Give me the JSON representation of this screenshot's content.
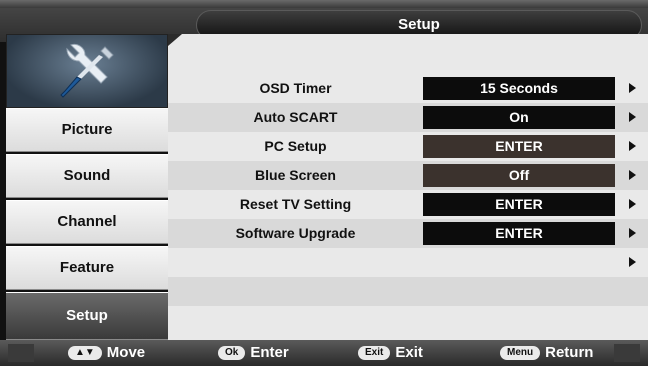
{
  "header": {
    "title": "Setup"
  },
  "sidebar": {
    "icon": "tools-icon",
    "items": [
      {
        "label": "Picture",
        "active": false
      },
      {
        "label": "Sound",
        "active": false
      },
      {
        "label": "Channel",
        "active": false
      },
      {
        "label": "Feature",
        "active": false
      },
      {
        "label": "Setup",
        "active": true
      }
    ]
  },
  "settings": [
    {
      "label": "OSD Timer",
      "value": "15 Seconds"
    },
    {
      "label": "Auto SCART",
      "value": "On"
    },
    {
      "label": "PC Setup",
      "value": "ENTER"
    },
    {
      "label": "Blue Screen",
      "value": "Off"
    },
    {
      "label": "Reset TV Setting",
      "value": "ENTER"
    },
    {
      "label": "Software Upgrade",
      "value": "ENTER"
    },
    {
      "label": "",
      "value": ""
    }
  ],
  "footer": {
    "hints": [
      {
        "key": "▲▼",
        "label": "Move"
      },
      {
        "key": "Ok",
        "label": "Enter"
      },
      {
        "key": "Exit",
        "label": "Exit"
      },
      {
        "key": "Menu",
        "label": "Return"
      }
    ]
  }
}
